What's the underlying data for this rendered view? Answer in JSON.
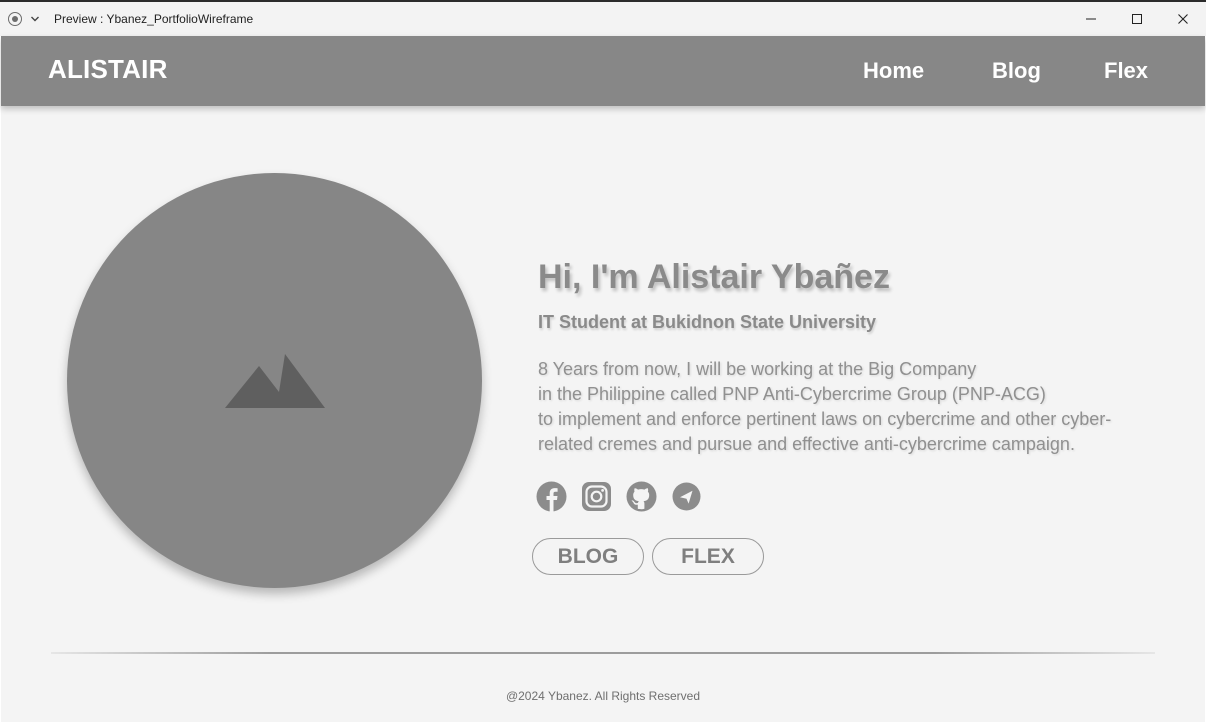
{
  "window": {
    "title": "Preview : Ybanez_PortfolioWireframe",
    "controls": [
      "minimize-icon",
      "maximize-icon",
      "close-icon"
    ]
  },
  "navbar": {
    "brand": "ALISTAIR",
    "links": [
      "Home",
      "Blog",
      "Flex"
    ]
  },
  "hero": {
    "avatar_icon": "image-placeholder-icon",
    "title": "Hi, I'm Alistair Ybañez",
    "subtitle": "IT Student at Bukidnon State University",
    "bio_lines": [
      "8 Years from now, I will be working at the Big Company",
      "in the Philippine called PNP Anti-Cybercrime Group (PNP-ACG)",
      "to implement and enforce pertinent laws on cybercrime and other cyber-",
      "related cremes and pursue and effective anti-cybercrime campaign."
    ],
    "socials": [
      "facebook-icon",
      "instagram-icon",
      "github-icon",
      "telegram-icon"
    ],
    "buttons": [
      "BLOG",
      "FLEX"
    ]
  },
  "footer": {
    "text": "@2024 Ybanez. All Rights Reserved"
  },
  "colors": {
    "navbar": "#878787",
    "background": "#f4f4f4",
    "avatar": "#868686",
    "text_gray": "#8a8a8a"
  }
}
